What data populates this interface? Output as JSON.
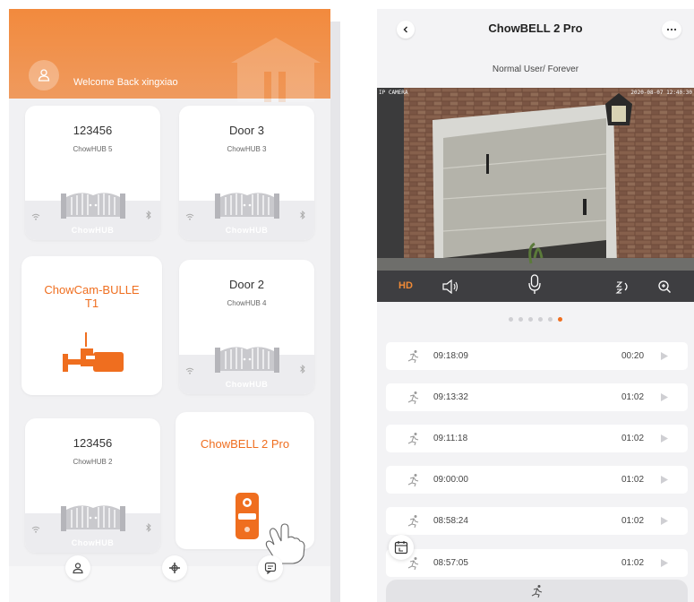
{
  "left": {
    "welcome": "Welcome Back xingxiao",
    "devices": [
      {
        "name": "123456",
        "model": "ChowHUB 5",
        "brand": "ChowHUB",
        "kind": "gate"
      },
      {
        "name": "Door 3",
        "model": "ChowHUB 3",
        "brand": "ChowHUB",
        "kind": "gate"
      },
      {
        "name": "ChowCam-BULLE T1",
        "model": "",
        "brand": "",
        "kind": "camera"
      },
      {
        "name": "Door 2",
        "model": "ChowHUB 4",
        "brand": "ChowHUB",
        "kind": "gate"
      },
      {
        "name": "123456",
        "model": "ChowHUB 2",
        "brand": "ChowHUB",
        "kind": "gate"
      },
      {
        "name": "ChowBELL 2 Pro",
        "model": "",
        "brand": "",
        "kind": "doorbell"
      }
    ],
    "bottom_nav": [
      "user-icon",
      "add-device-icon",
      "message-icon"
    ]
  },
  "right": {
    "title": "ChowBELL 2 Pro",
    "role": "Normal User/ Forever",
    "video": {
      "camera_label": "IP CAMERA",
      "timestamp": "2020-08-07 12:40:30"
    },
    "controls": {
      "quality": "HD"
    },
    "pager": {
      "count": 6,
      "active": 5
    },
    "records": [
      {
        "time": "09:18:09",
        "duration": "00:20"
      },
      {
        "time": "09:13:32",
        "duration": "01:02"
      },
      {
        "time": "09:11:18",
        "duration": "01:02"
      },
      {
        "time": "09:00:00",
        "duration": "01:02"
      },
      {
        "time": "08:58:24",
        "duration": "01:02"
      },
      {
        "time": "08:57:05",
        "duration": "01:02"
      }
    ]
  },
  "colors": {
    "accent": "#ef6e1f",
    "header": "#f28a3d",
    "control_bar": "#3e3e41"
  }
}
